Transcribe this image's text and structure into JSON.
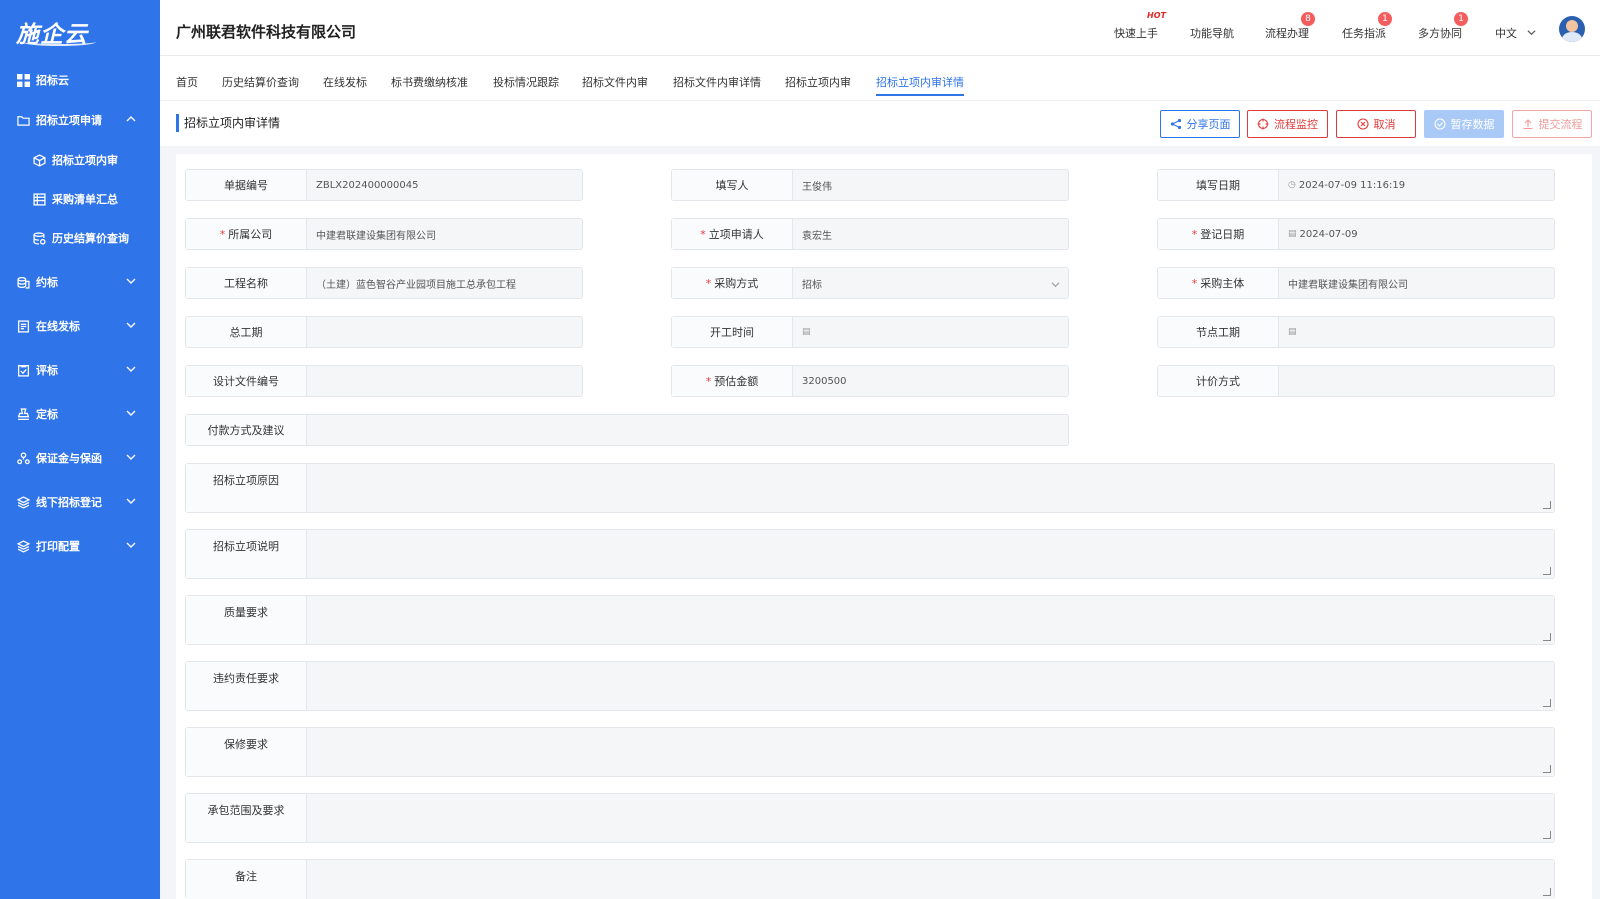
{
  "app": {
    "logo": "施企云"
  },
  "sidebar": {
    "items": [
      {
        "label": "招标云",
        "icon": "grid-icon"
      },
      {
        "label": "招标立项申请",
        "icon": "folder-icon"
      },
      {
        "label": "招标立项内审",
        "icon": "cube-icon"
      },
      {
        "label": "采购清单汇总",
        "icon": "list-icon"
      },
      {
        "label": "历史结算价查询",
        "icon": "database-icon"
      },
      {
        "label": "约标",
        "icon": "coins-icon"
      },
      {
        "label": "在线发标",
        "icon": "document-icon"
      },
      {
        "label": "评标",
        "icon": "clipboard-check-icon"
      },
      {
        "label": "定标",
        "icon": "stamp-icon"
      },
      {
        "label": "保证金与保函",
        "icon": "people-icon"
      },
      {
        "label": "线下招标登记",
        "icon": "layers-icon"
      },
      {
        "label": "打印配置",
        "icon": "layers-icon"
      }
    ]
  },
  "topbar": {
    "company": "广州联君软件科技有限公司",
    "quick_start": "快速上手",
    "hot_label": "HOT",
    "nav_guide": "功能导航",
    "process": "流程办理",
    "process_badge": "8",
    "task": "任务指派",
    "task_badge": "1",
    "collab": "多方协同",
    "collab_badge": "1",
    "language": "中文"
  },
  "tabs": [
    "首页",
    "历史结算价查询",
    "在线发标",
    "标书费缴纳核准",
    "投标情况跟踪",
    "招标文件内审",
    "招标文件内审详情",
    "招标立项内审",
    "招标立项内审详情"
  ],
  "page": {
    "title": "招标立项内审详情",
    "buttons": {
      "share": "分享页面",
      "monitor": "流程监控",
      "cancel": "取消",
      "save_draft": "暂存数据",
      "submit": "提交流程"
    }
  },
  "form": {
    "doc_no": {
      "label": "单据编号",
      "value": "ZBLX202400000045"
    },
    "writer": {
      "label": "填写人",
      "value": "王俊伟"
    },
    "write_date": {
      "label": "填写日期",
      "value": "2024-07-09 11:16:19"
    },
    "company": {
      "label": "所属公司",
      "value": "中建君联建设集团有限公司"
    },
    "applicant": {
      "label": "立项申请人",
      "value": "袁宏生"
    },
    "reg_date": {
      "label": "登记日期",
      "value": "2024-07-09"
    },
    "project_name": {
      "label": "工程名称",
      "value": "（土建）蓝色智谷产业园项目施工总承包工程"
    },
    "purchase_method": {
      "label": "采购方式",
      "value": "招标"
    },
    "purchase_subject": {
      "label": "采购主体",
      "value": "中建君联建设集团有限公司"
    },
    "total_period": {
      "label": "总工期",
      "value": ""
    },
    "start_time": {
      "label": "开工时间",
      "value": ""
    },
    "node_period": {
      "label": "节点工期",
      "value": ""
    },
    "design_doc_no": {
      "label": "设计文件编号",
      "value": ""
    },
    "estimated_amount": {
      "label": "预估金额",
      "value": "3200500"
    },
    "pricing_method": {
      "label": "计价方式",
      "value": ""
    },
    "payment": {
      "label": "付款方式及建议",
      "value": ""
    },
    "reason": {
      "label": "招标立项原因"
    },
    "description": {
      "label": "招标立项说明"
    },
    "quality": {
      "label": "质量要求"
    },
    "liability": {
      "label": "违约责任要求"
    },
    "warranty": {
      "label": "保修要求"
    },
    "scope": {
      "label": "承包范围及要求"
    },
    "remark": {
      "label": "备注"
    }
  }
}
